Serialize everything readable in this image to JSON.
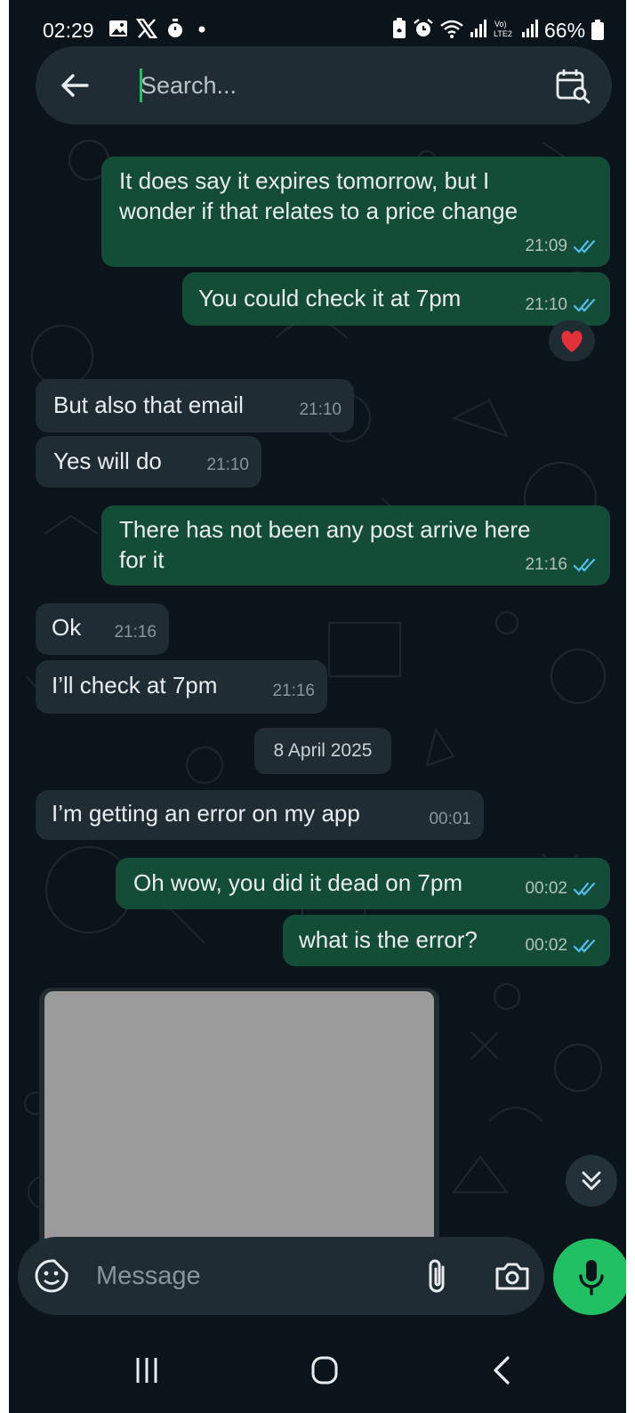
{
  "status_bar": {
    "time": "02:29",
    "battery_percent": "66%",
    "left_icons": [
      "gallery-icon",
      "x-logo-icon",
      "stopwatch-icon",
      "dot-icon"
    ],
    "right_icons": [
      "battery-saver-icon",
      "alarm-icon",
      "wifi-icon",
      "signal-icon",
      "volte-lte2-icon",
      "signal-icon",
      "battery-icon"
    ]
  },
  "search": {
    "placeholder": "Search...",
    "value": ""
  },
  "messages": [
    {
      "direction": "out",
      "lines": [
        "It does say it expires tomorrow, but I",
        "wonder if that relates to a price change"
      ],
      "time": "21:09",
      "status": "read"
    },
    {
      "direction": "out",
      "lines": [
        "You could check it at 7pm"
      ],
      "time": "21:10",
      "status": "read",
      "reaction": "heart"
    },
    {
      "direction": "in",
      "lines": [
        "But also that email"
      ],
      "time": "21:10"
    },
    {
      "direction": "in",
      "lines": [
        "Yes will do"
      ],
      "time": "21:10"
    },
    {
      "direction": "out",
      "lines": [
        "There has not been any post arrive here",
        "for it"
      ],
      "time": "21:16",
      "status": "read"
    },
    {
      "direction": "in",
      "lines": [
        "Ok"
      ],
      "time": "21:16"
    },
    {
      "direction": "in",
      "lines": [
        "I’ll check at 7pm"
      ],
      "time": "21:16"
    },
    {
      "direction": "in",
      "lines": [
        "I’m getting an error on my app"
      ],
      "time": "00:01"
    },
    {
      "direction": "out",
      "lines": [
        "Oh wow, you did it dead on 7pm"
      ],
      "time": "00:02",
      "status": "read"
    },
    {
      "direction": "out",
      "lines": [
        "what is the error?"
      ],
      "time": "00:02",
      "status": "read"
    }
  ],
  "date_separator": "8 April 2025",
  "image_message": {
    "direction": "in",
    "content": "redacted-image"
  },
  "composer": {
    "placeholder": "Message",
    "value": ""
  },
  "colors": {
    "background": "#0b141a",
    "outgoing_bubble": "#144d37",
    "incoming_bubble": "#1f2c33",
    "accent_green": "#21c063",
    "read_tick": "#53bdeb"
  },
  "nav_buttons": [
    "recents-icon",
    "home-icon",
    "back-icon"
  ]
}
